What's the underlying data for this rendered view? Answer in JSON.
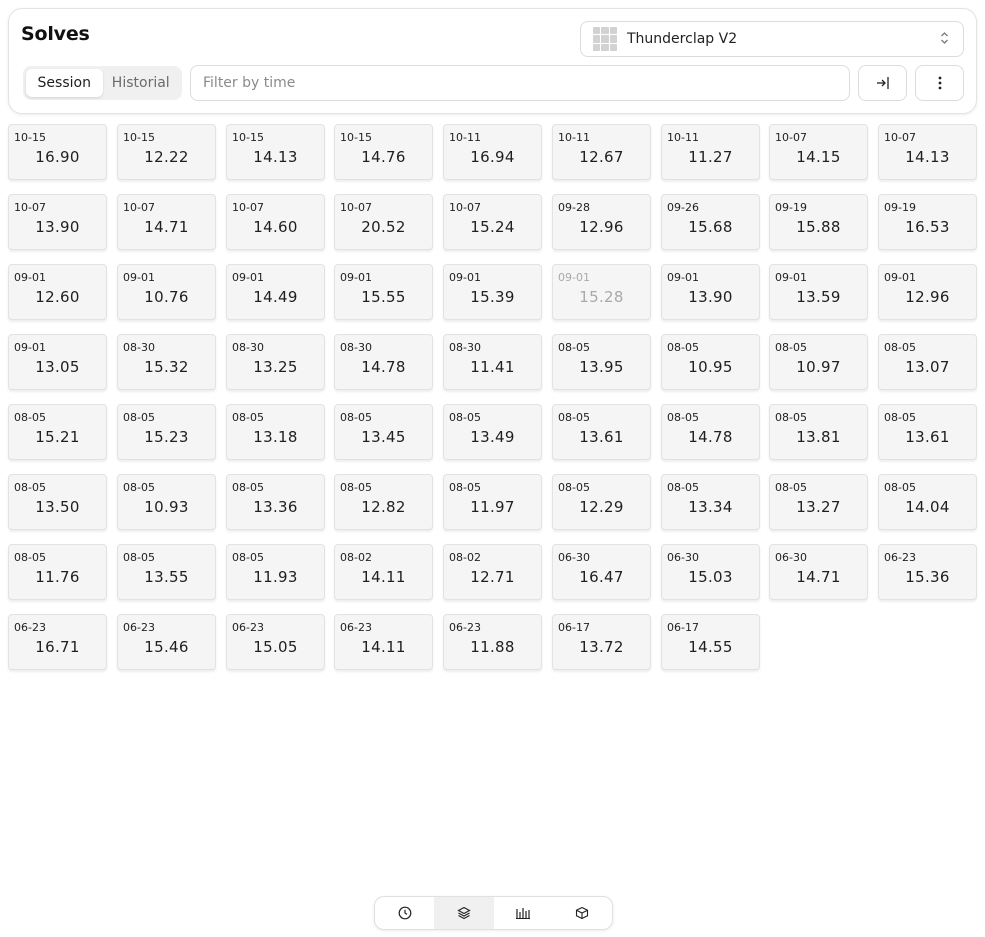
{
  "header": {
    "title": "Solves",
    "cube_select": {
      "value": "Thunderclap V2",
      "icon": "cube-thumbnail-icon"
    },
    "tabs": [
      {
        "label": "Session",
        "active": true
      },
      {
        "label": "Historial",
        "active": false
      }
    ],
    "filter": {
      "placeholder": "Filter by time",
      "value": ""
    },
    "actions": [
      {
        "icon": "import-icon"
      },
      {
        "icon": "more-vertical-icon"
      }
    ]
  },
  "solves": [
    {
      "date": "10-15",
      "time": "16.90"
    },
    {
      "date": "10-15",
      "time": "12.22"
    },
    {
      "date": "10-15",
      "time": "14.13"
    },
    {
      "date": "10-15",
      "time": "14.76"
    },
    {
      "date": "10-11",
      "time": "16.94"
    },
    {
      "date": "10-11",
      "time": "12.67"
    },
    {
      "date": "10-11",
      "time": "11.27"
    },
    {
      "date": "10-07",
      "time": "14.15"
    },
    {
      "date": "10-07",
      "time": "14.13"
    },
    {
      "date": "10-07",
      "time": "13.90"
    },
    {
      "date": "10-07",
      "time": "14.71"
    },
    {
      "date": "10-07",
      "time": "14.60"
    },
    {
      "date": "10-07",
      "time": "20.52"
    },
    {
      "date": "10-07",
      "time": "15.24"
    },
    {
      "date": "09-28",
      "time": "12.96"
    },
    {
      "date": "09-26",
      "time": "15.68"
    },
    {
      "date": "09-19",
      "time": "15.88"
    },
    {
      "date": "09-19",
      "time": "16.53"
    },
    {
      "date": "09-01",
      "time": "12.60"
    },
    {
      "date": "09-01",
      "time": "10.76"
    },
    {
      "date": "09-01",
      "time": "14.49"
    },
    {
      "date": "09-01",
      "time": "15.55"
    },
    {
      "date": "09-01",
      "time": "15.39"
    },
    {
      "date": "09-01",
      "time": "15.28",
      "dnf": true
    },
    {
      "date": "09-01",
      "time": "13.90"
    },
    {
      "date": "09-01",
      "time": "13.59"
    },
    {
      "date": "09-01",
      "time": "12.96"
    },
    {
      "date": "09-01",
      "time": "13.05"
    },
    {
      "date": "08-30",
      "time": "15.32"
    },
    {
      "date": "08-30",
      "time": "13.25"
    },
    {
      "date": "08-30",
      "time": "14.78"
    },
    {
      "date": "08-30",
      "time": "11.41"
    },
    {
      "date": "08-05",
      "time": "13.95"
    },
    {
      "date": "08-05",
      "time": "10.95"
    },
    {
      "date": "08-05",
      "time": "10.97"
    },
    {
      "date": "08-05",
      "time": "13.07"
    },
    {
      "date": "08-05",
      "time": "15.21"
    },
    {
      "date": "08-05",
      "time": "15.23"
    },
    {
      "date": "08-05",
      "time": "13.18"
    },
    {
      "date": "08-05",
      "time": "13.45"
    },
    {
      "date": "08-05",
      "time": "13.49"
    },
    {
      "date": "08-05",
      "time": "13.61"
    },
    {
      "date": "08-05",
      "time": "14.78"
    },
    {
      "date": "08-05",
      "time": "13.81"
    },
    {
      "date": "08-05",
      "time": "13.61"
    },
    {
      "date": "08-05",
      "time": "13.50"
    },
    {
      "date": "08-05",
      "time": "10.93"
    },
    {
      "date": "08-05",
      "time": "13.36"
    },
    {
      "date": "08-05",
      "time": "12.82"
    },
    {
      "date": "08-05",
      "time": "11.97"
    },
    {
      "date": "08-05",
      "time": "12.29"
    },
    {
      "date": "08-05",
      "time": "13.34"
    },
    {
      "date": "08-05",
      "time": "13.27"
    },
    {
      "date": "08-05",
      "time": "14.04"
    },
    {
      "date": "08-05",
      "time": "11.76"
    },
    {
      "date": "08-05",
      "time": "13.55"
    },
    {
      "date": "08-05",
      "time": "11.93"
    },
    {
      "date": "08-02",
      "time": "14.11"
    },
    {
      "date": "08-02",
      "time": "12.71"
    },
    {
      "date": "06-30",
      "time": "16.47"
    },
    {
      "date": "06-30",
      "time": "15.03"
    },
    {
      "date": "06-30",
      "time": "14.71"
    },
    {
      "date": "06-23",
      "time": "15.36"
    },
    {
      "date": "06-23",
      "time": "16.71"
    },
    {
      "date": "06-23",
      "time": "15.46"
    },
    {
      "date": "06-23",
      "time": "15.05"
    },
    {
      "date": "06-23",
      "time": "14.11"
    },
    {
      "date": "06-23",
      "time": "11.88"
    },
    {
      "date": "06-17",
      "time": "13.72"
    },
    {
      "date": "06-17",
      "time": "14.55"
    }
  ],
  "bottom_nav": [
    {
      "icon": "clock-icon",
      "active": false
    },
    {
      "icon": "layers-icon",
      "active": true
    },
    {
      "icon": "bar-chart-icon",
      "active": false
    },
    {
      "icon": "cube-icon",
      "active": false
    }
  ]
}
